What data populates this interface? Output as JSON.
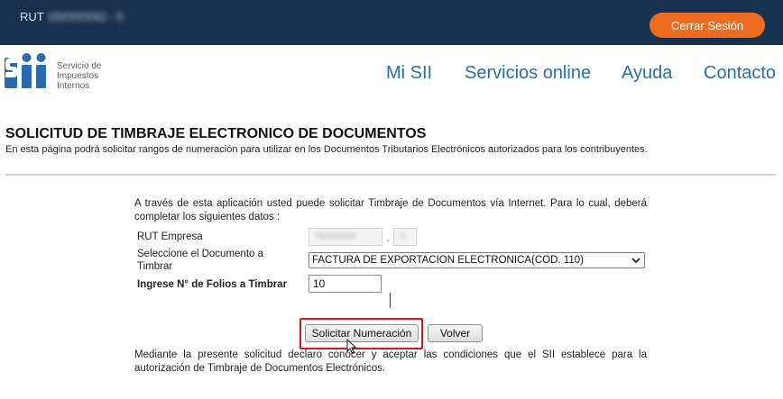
{
  "topbar": {
    "rut_label": "RUT",
    "rut_value": "15XXXXX2 - 5",
    "logout_label": "Cerrar Sesión"
  },
  "header": {
    "logo_text": [
      "Servicio de",
      "Impuestos",
      "Internos"
    ],
    "nav": [
      "Mi SII",
      "Servicios online",
      "Ayuda",
      "Contacto"
    ]
  },
  "page": {
    "title": "SOLICITUD DE TIMBRAJE ELECTRONICO DE DOCUMENTOS",
    "description": "En esta página podrá solicitar rangos de numeración para utilizar en los Documentos Tributarios Electrónicos autorizados para los contribuyentes."
  },
  "form": {
    "intro": "A través de esta aplicación usted puede solicitar Timbraje de Documentos vía Internet. Para lo cual, deberá completar los siguientes datos :",
    "rut_empresa_label": "RUT Empresa",
    "rut_empresa_value": "76XXXXXX",
    "rut_empresa_dv": "X",
    "doc_label_1": "Seleccione el Documento a",
    "doc_label_2": "Timbrar",
    "doc_selected": "FACTURA DE EXPORTACION ELECTRONICA(COD. 110)",
    "folios_label": "Ingrese N° de Folios a Timbrar",
    "folios_value": "10",
    "submit_label": "Solicitar Numeración",
    "back_label": "Volver",
    "declaration": "Mediante la presente solicitud declaro conocer y aceptar las condiciones que el SII establece para la autorización de Timbraje de Documentos Electrónicos."
  },
  "colors": {
    "topbar": "#17314f",
    "logout": "#ee6c20",
    "nav": "#2670a8",
    "logo": "#2a6bb0",
    "highlight": "#e0141e"
  },
  "icons": {
    "logo": "sii-logo",
    "select_arrow": "chevron-down-icon",
    "pointer": "mouse-cursor-icon"
  }
}
